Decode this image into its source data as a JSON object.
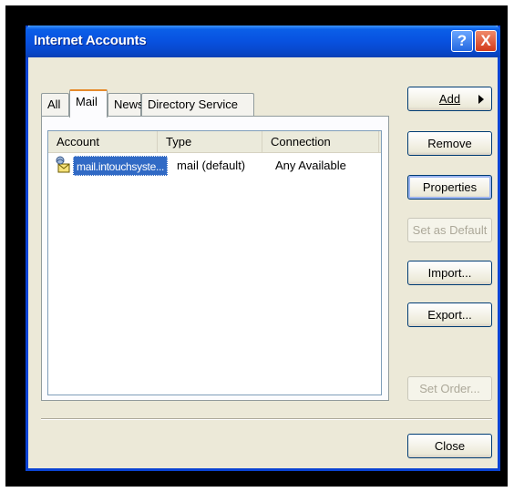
{
  "window": {
    "title": "Internet Accounts",
    "help_glyph": "?",
    "close_glyph": "X"
  },
  "tabs": [
    {
      "label": "All"
    },
    {
      "label": "Mail",
      "selected": true
    },
    {
      "label": "News"
    },
    {
      "label": "Directory Service"
    }
  ],
  "list": {
    "columns": [
      "Account",
      "Type",
      "Connection"
    ],
    "rows": [
      {
        "account": "mail.intouchsyste...",
        "type": "mail (default)",
        "connection": "Any Available",
        "selected": true,
        "icon": "mail-account-icon"
      }
    ]
  },
  "buttons": {
    "add": "Add",
    "remove": "Remove",
    "properties": "Properties",
    "set_default": "Set as Default",
    "import": "Import...",
    "export": "Export...",
    "set_order": "Set Order...",
    "close": "Close"
  },
  "colors": {
    "titlebar": "#0a5fe8",
    "selection": "#316ac5",
    "dialog_bg": "#ece9d8"
  }
}
